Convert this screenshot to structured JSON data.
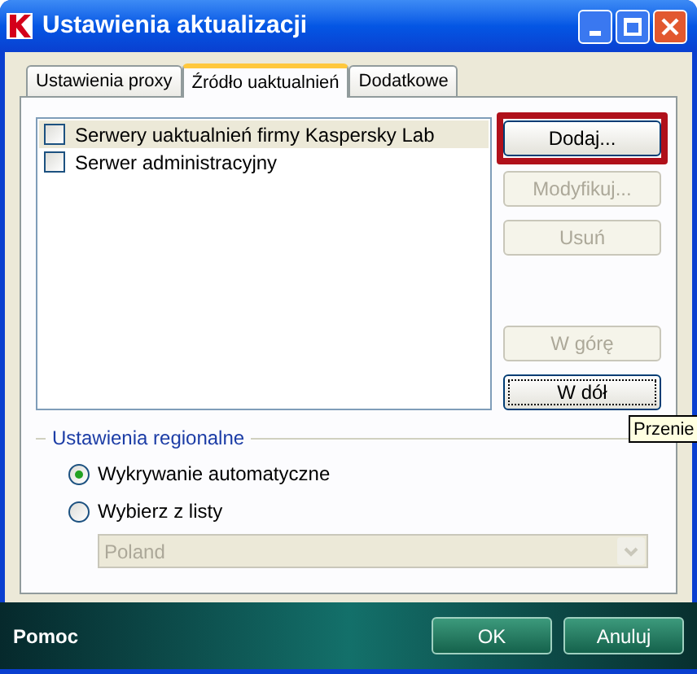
{
  "window": {
    "title": "Ustawienia aktualizacji"
  },
  "tabs": [
    {
      "label": "Ustawienia proxy",
      "selected": false
    },
    {
      "label": "Źródło uaktualnień",
      "selected": true
    },
    {
      "label": "Dodatkowe",
      "selected": false
    }
  ],
  "sources": [
    {
      "label": "Serwery uaktualnień firmy Kaspersky Lab",
      "checked": false,
      "selected": true
    },
    {
      "label": "Serwer administracyjny",
      "checked": false,
      "selected": false
    }
  ],
  "side_buttons": [
    {
      "label": "Dodaj...",
      "disabled": false,
      "highlighted": true,
      "focused": false
    },
    {
      "label": "Modyfikuj...",
      "disabled": true,
      "highlighted": false,
      "focused": false
    },
    {
      "label": "Usuń",
      "disabled": true,
      "highlighted": false,
      "focused": false
    },
    {
      "label": "W górę",
      "disabled": true,
      "highlighted": false,
      "focused": false
    },
    {
      "label": "W dół",
      "disabled": false,
      "highlighted": false,
      "focused": true
    }
  ],
  "tooltip": "Przenie",
  "regional": {
    "title": "Ustawienia regionalne",
    "options": [
      {
        "label": "Wykrywanie automatyczne",
        "selected": true
      },
      {
        "label": "Wybierz z listy",
        "selected": false
      }
    ],
    "country": {
      "value": "Poland",
      "disabled": true
    }
  },
  "footer": {
    "help": "Pomoc",
    "buttons": [
      "OK",
      "Anuluj"
    ]
  }
}
